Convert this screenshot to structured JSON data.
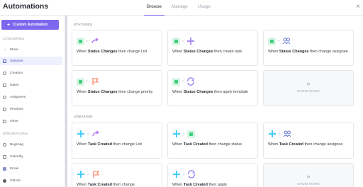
{
  "app": {
    "title": "Automations",
    "close_glyph": "×"
  },
  "tabs": [
    {
      "label": "Browse",
      "active": true
    },
    {
      "label": "Manage",
      "active": false
    },
    {
      "label": "Usage",
      "active": false
    }
  ],
  "sidebar": {
    "custom_button_label": "Custom Automation",
    "categories_label": "CATEGORIES",
    "categories": [
      {
        "label": "Move",
        "icon": "arrow-right-icon"
      },
      {
        "label": "Statuses",
        "icon": "status-icon",
        "active": true
      },
      {
        "label": "Creation",
        "icon": "plus-icon"
      },
      {
        "label": "Dates",
        "icon": "calendar-icon"
      },
      {
        "label": "Assignees",
        "icon": "people-icon"
      },
      {
        "label": "Priorities",
        "icon": "flag-icon"
      },
      {
        "label": "Other",
        "icon": "tag-icon"
      }
    ],
    "integrations_label": "INTEGRATIONS",
    "integrations": [
      {
        "label": "Bugsnag",
        "icon": "bugsnag-icon"
      },
      {
        "label": "Calendly",
        "icon": "calendly-icon"
      },
      {
        "label": "Email",
        "icon": "email-icon"
      },
      {
        "label": "GitHub",
        "icon": "github-icon"
      }
    ]
  },
  "main": {
    "statuses_label": "STATUSES",
    "creation_label": "CREATION",
    "show_more_label": "SHOW MORE",
    "status_cards": [
      {
        "when": "When",
        "trigger": "Status Changes",
        "then": "then",
        "action": "change List"
      },
      {
        "when": "When",
        "trigger": "Status Changes",
        "then": "then",
        "action": "create task"
      },
      {
        "when": "When",
        "trigger": "Status Changes",
        "then": "then",
        "action": "change assignee"
      },
      {
        "when": "When",
        "trigger": "Status Changes",
        "then": "then",
        "action": "change priority"
      },
      {
        "when": "When",
        "trigger": "Status Changes",
        "then": "then",
        "action": "apply template"
      }
    ],
    "creation_cards": [
      {
        "when": "When",
        "trigger": "Task Created",
        "then": "then",
        "action": "change List"
      },
      {
        "when": "When",
        "trigger": "Task Created",
        "then": "then",
        "action": "change status"
      },
      {
        "when": "When",
        "trigger": "Task Created",
        "then": "then",
        "action": "change assignee"
      },
      {
        "when": "When",
        "trigger": "Task Created",
        "then": "then",
        "action": "change"
      },
      {
        "when": "When",
        "trigger": "Task Created",
        "then": "then",
        "action": "apply"
      }
    ]
  },
  "colors": {
    "accent": "#7b68ee",
    "status_green": "#3ecf7d",
    "create_blue": "#49ccf9",
    "priority_orange": "#fd7e5f"
  }
}
